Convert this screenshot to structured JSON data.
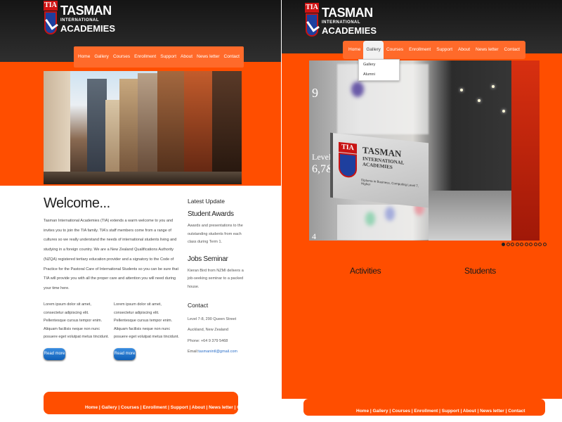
{
  "brand": {
    "badge": "TIA",
    "line1": "TASMAN",
    "line2": "INTERNATIONAL",
    "line3": "ACADEMIES"
  },
  "colors": {
    "accent": "#ff4e00",
    "nav": "#ff6a2a",
    "header_dark": "#1f1f1f",
    "button_blue": "#1a6fc8"
  },
  "nav": {
    "items": [
      "Home",
      "Gallery",
      "Courses",
      "Enrollment",
      "Support",
      "About",
      "News letter",
      "Contact"
    ]
  },
  "left_page": {
    "welcome": {
      "title": "Welcome...",
      "body": "Tasman International Academies (TIA) extends a warm welcome to you and invites you to join the TIA family. TIA's staff members come from a range of cultures so we really understand the needs of international students living and studying in a foreign country. We are a New Zealand Qualifications Authority (NZQA) registered tertiary education provider and a signatory to the Code of Practice for the Pastoral Care of International Students so you can be sure that TIA will provide you with all the proper care and attention you will need during your time here."
    },
    "columns": [
      {
        "text": "Lorem ipsum dolor sit amet, consectetur adipiscing elit. Pellentesque cursus tempor enim. Aliquam facilisis neque non nunc posuere eget volutpat metus tincidunt.",
        "button": "Read more"
      },
      {
        "text": "Lorem ipsum dolor sit amet, consectetur adipiscing elit. Pellentesque cursus tempor enim. Aliquam facilisis neque non nunc posuere eget volutpat metus tincidunt.",
        "button": "Read more"
      }
    ],
    "aside": {
      "latest": "Latest Update",
      "awards_title": "Student Awards",
      "awards_text": "Awards and presentations to the outstanding students from each class during Term 1.",
      "jobs_title": "Jobs Seminar",
      "jobs_text": "Kieran Bird from NZMI delivers a job-seeking seminar to a packed house.",
      "contact_title": "Contact",
      "address1": "Level 7-8, 290 Queen Street",
      "address2": "Auckland, New Zealand",
      "phone": "Phone: +64 9 379 5468",
      "email_label": "Email:",
      "email": "tasmanintl@gmail.com"
    },
    "footer": "Home | Gallery | Courses | Enrollment | Support | About | News letter | Contact"
  },
  "right_page": {
    "active_nav": "Gallery",
    "dropdown": [
      "Gallery",
      "Alumni"
    ],
    "slide": {
      "levels": [
        "9",
        "Level",
        "6,7&8",
        "4"
      ],
      "sign_badge": "TIA",
      "sign_title": "TASMAN",
      "sign_sub": "INTERNATIONAL ACADEMIES",
      "sign_sub2": "Diploma in Business, Computing Level 7, Higher"
    },
    "slider_dots": 10,
    "captions": [
      "Activities",
      "Students"
    ],
    "footer": "Home | Gallery | Courses | Enrollment | Support | About | News letter | Contact"
  }
}
